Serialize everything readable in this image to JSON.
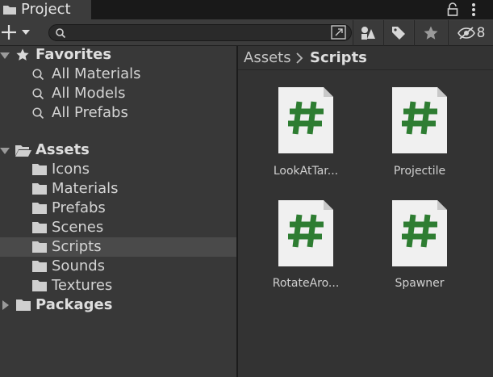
{
  "tab": {
    "title": "Project"
  },
  "toolbar": {
    "search_placeholder": "",
    "hidden_count": "8"
  },
  "favorites": {
    "label": "Favorites",
    "items": [
      "All Materials",
      "All Models",
      "All Prefabs"
    ]
  },
  "assets": {
    "label": "Assets",
    "folders": [
      "Icons",
      "Materials",
      "Prefabs",
      "Scenes",
      "Scripts",
      "Sounds",
      "Textures"
    ],
    "selected": "Scripts"
  },
  "packages": {
    "label": "Packages"
  },
  "breadcrumb": {
    "root": "Assets",
    "current": "Scripts"
  },
  "files": [
    {
      "name": "LookAtTar..."
    },
    {
      "name": "Projectile"
    },
    {
      "name": "RotateAro..."
    },
    {
      "name": "Spawner"
    }
  ],
  "colors": {
    "script_green": "#2e7d32",
    "page_bg": "#f0f0f0"
  }
}
